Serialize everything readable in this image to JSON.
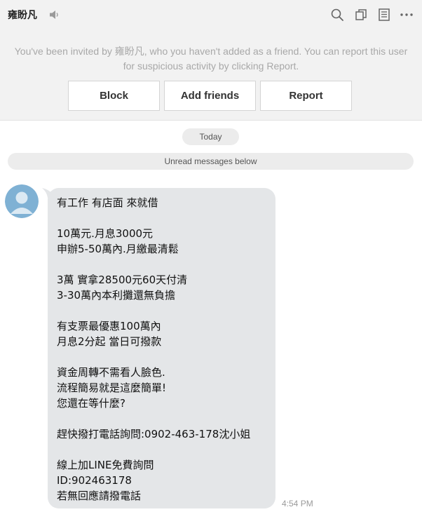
{
  "header": {
    "title": "雍盼凡",
    "icons": [
      "speaker-muted-icon",
      "search-icon",
      "copy-icon",
      "document-icon",
      "more-icon"
    ]
  },
  "banner": {
    "notice": "You've been invited by 雍盼凡, who you haven't added as a friend. You can report this user for suspicious activity by clicking Report.",
    "block_label": "Block",
    "add_friends_label": "Add friends",
    "report_label": "Report"
  },
  "chat": {
    "date_label": "Today",
    "unread_label": "Unread messages below",
    "message": {
      "lines": [
        "有工作 有店面 來就借",
        "",
        "10萬元.月息3000元",
        "申辦5-50萬內.月繳最清鬆",
        "",
        "3萬 實拿28500元60天付清",
        "3-30萬內本利攤還無負擔",
        "",
        "有支票最優惠100萬內",
        "月息2分起 當日可撥款",
        "",
        "資金周轉不需看人臉色.",
        "流程簡易就是這麼簡單!",
        "您還在等什麼?",
        "",
        "趕快撥打電話詢問:0902-463-178沈小姐",
        "",
        "線上加LINE免費詢問",
        "ID:902463178",
        "若無回應請撥電話"
      ],
      "time": "4:54 PM"
    }
  },
  "colors": {
    "header_bg": "#f2f2f2",
    "bubble_bg": "#e4e6e8",
    "avatar_bg": "#7fb1d4",
    "notice_text": "#a8a8a8"
  }
}
